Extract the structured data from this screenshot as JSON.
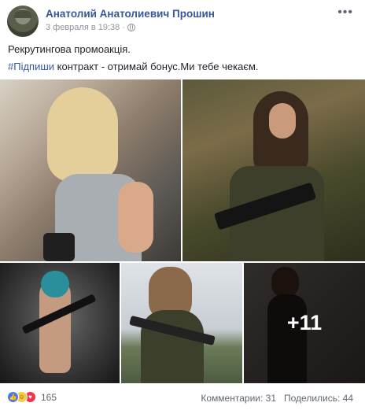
{
  "post": {
    "author": "Анатолий Анатолиевич Прошин",
    "date": "3 февраля в 19:38",
    "separator": "·",
    "privacy_icon": "globe-icon",
    "more_icon": "more-options-icon",
    "line1": "Рекрутингова промоакція.",
    "hashtag": "#Підпиши",
    "line2_rest": " контракт - отримай бонус.Ми тебе чекаєм."
  },
  "photos": {
    "more_count": "+11"
  },
  "footer": {
    "reactions_icons": [
      "like-icon",
      "haha-icon",
      "love-icon"
    ],
    "reaction_count": "165",
    "comments": "Комментарии: 31",
    "shares": "Поделились: 44"
  },
  "colors": {
    "link": "#365899",
    "meta": "#90949c",
    "like": "#4a76e8",
    "love": "#f0344b",
    "haha": "#f7c843"
  }
}
